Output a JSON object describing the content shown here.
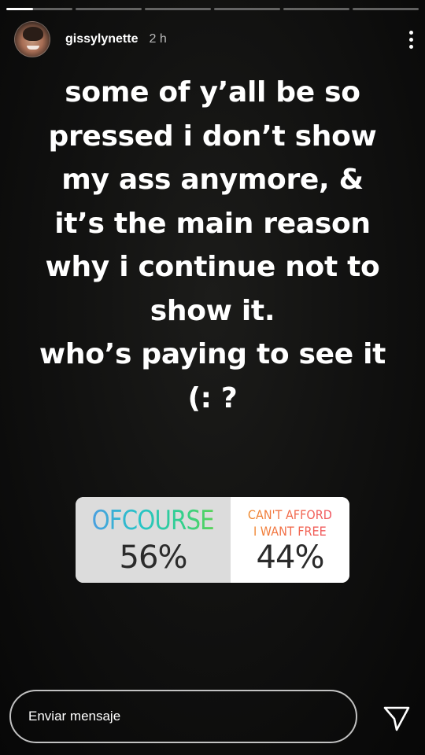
{
  "story": {
    "progress": {
      "segments": 6,
      "active_index": 0,
      "active_fraction": 0.4
    },
    "header": {
      "username": "gissylynette",
      "time_ago": "2 h"
    },
    "text": "some of y’all be so\npressed i don’t show\nmy ass anymore, &\nit’s the main reason\nwhy i continue not to\nshow it.\nwho’s paying to see it\n(: ?",
    "poll": {
      "options": [
        {
          "label": "OFCOURSE",
          "percent": "56%",
          "percent_value": 56
        },
        {
          "label": "CAN'T AFFORD\nI WANT FREE",
          "percent": "44%",
          "percent_value": 44
        }
      ]
    },
    "footer": {
      "message_placeholder": "Enviar mensaje"
    }
  },
  "colors": {
    "background": "#121211",
    "poll_left_bg": "#dcdcdc",
    "poll_right_bg": "#ffffff",
    "option1_gradient": [
      "#4a9fe0",
      "#59d35a"
    ],
    "option2_gradient": [
      "#f08a2c",
      "#f0525e"
    ]
  },
  "icons": {
    "more": "more-vertical-icon",
    "send": "paper-plane-icon"
  }
}
